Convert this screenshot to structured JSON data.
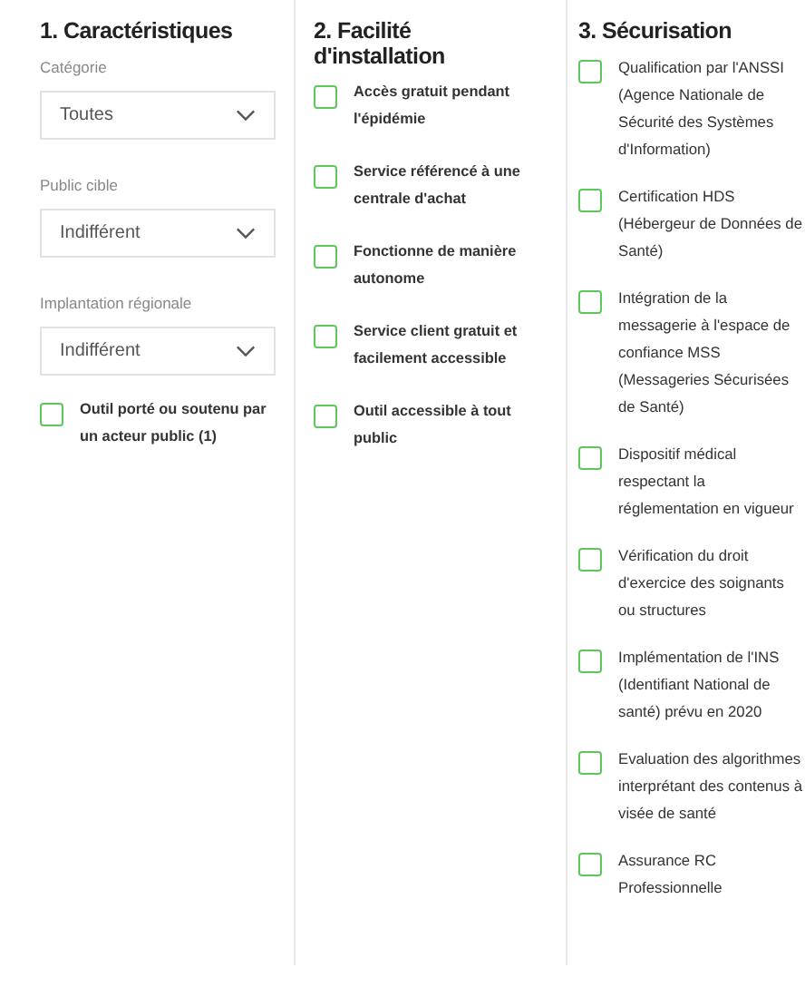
{
  "columns": [
    {
      "title": "1. Caractéristiques",
      "filters": [
        {
          "kind": "select",
          "label": "Catégorie",
          "value": "Toutes"
        },
        {
          "kind": "select",
          "label": "Public cible",
          "value": "Indifférent"
        },
        {
          "kind": "select",
          "label": "Implantation régionale",
          "value": "Indifférent"
        },
        {
          "kind": "checkbox",
          "label": "Outil porté ou soutenu par un acteur public (1)",
          "checked": false
        }
      ]
    },
    {
      "title": "2. Facilité d'installation",
      "filters": [
        {
          "kind": "checkbox",
          "label": "Accès gratuit pendant l'épidémie",
          "checked": false
        },
        {
          "kind": "checkbox",
          "label": "Service référencé à une centrale d'achat",
          "checked": false
        },
        {
          "kind": "checkbox",
          "label": "Fonctionne de manière autonome",
          "checked": false
        },
        {
          "kind": "checkbox",
          "label": "Service client gratuit et facilement accessible",
          "checked": false
        },
        {
          "kind": "checkbox",
          "label": "Outil accessible à tout public",
          "checked": false
        }
      ]
    },
    {
      "title": "3. Sécurisation",
      "filters": [
        {
          "kind": "checkbox",
          "label": "Qualification par l'ANSSI (Agence Nationale de Sécurité des Systèmes d'Information)",
          "checked": false
        },
        {
          "kind": "checkbox",
          "label": "Certification HDS (Hébergeur de Données de Santé)",
          "checked": false
        },
        {
          "kind": "checkbox",
          "label": "Intégration de la messagerie à l'espace de confiance MSS (Messageries Sécurisées de Santé)",
          "checked": false
        },
        {
          "kind": "checkbox",
          "label": "Dispositif médical respectant la réglementation en vigueur",
          "checked": false
        },
        {
          "kind": "checkbox",
          "label": "Vérification du droit d'exercice des soignants ou structures",
          "checked": false
        },
        {
          "kind": "checkbox",
          "label": "Implémentation de l'INS (Identifiant National de santé) prévu en 2020",
          "checked": false
        },
        {
          "kind": "checkbox",
          "label": "Evaluation des algorithmes interprétant des contenus à visée de santé",
          "checked": false
        },
        {
          "kind": "checkbox",
          "label": "Assurance RC Professionnelle",
          "checked": false
        }
      ]
    }
  ]
}
